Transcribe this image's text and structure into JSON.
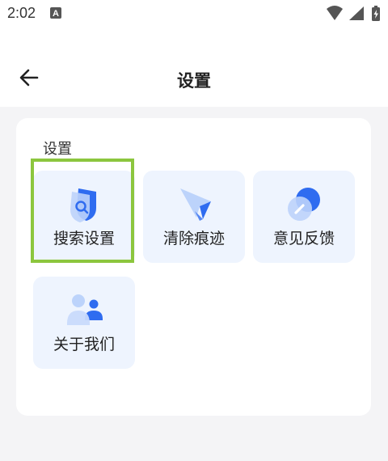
{
  "status_bar": {
    "time": "2:02",
    "notification_badge": "A",
    "icons": [
      "wifi-icon",
      "cellular-signal-icon",
      "battery-charging-icon"
    ]
  },
  "header": {
    "title": "设置",
    "back_icon": "back-arrow-icon"
  },
  "section": {
    "label": "设置",
    "tiles": [
      {
        "label": "搜索设置",
        "icon": "search-settings-shield-icon",
        "selected": true
      },
      {
        "label": "清除痕迹",
        "icon": "clear-traces-cursor-icon",
        "selected": false
      },
      {
        "label": "意见反馈",
        "icon": "feedback-pencil-icon",
        "selected": false
      },
      {
        "label": "关于我们",
        "icon": "about-us-people-icon",
        "selected": false
      }
    ]
  },
  "colors": {
    "accent_blue": "#2f6cf0",
    "tile_bg": "#eef4fe",
    "selection_frame": "#8cc63e"
  }
}
